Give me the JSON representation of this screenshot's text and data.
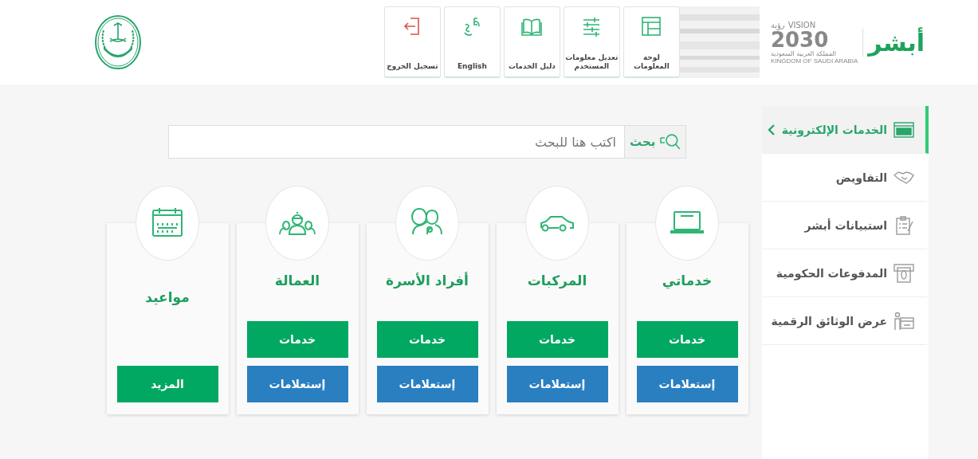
{
  "header": {
    "logo": {
      "mark": "أبشر",
      "vision": "VISION",
      "vision_ar": "رؤية",
      "year": "2030",
      "country_ar": "المملكة العربية السعودية",
      "country_en": "KINGDOM OF SAUDI ARABIA"
    },
    "nav": [
      {
        "label": "لوحة المعلومات"
      },
      {
        "label": "تعديل معلومات المستخدم"
      },
      {
        "label": "دليل الخدمات"
      },
      {
        "label": "English"
      },
      {
        "label": "تسجيل الخروج"
      }
    ]
  },
  "sidebar": {
    "items": [
      {
        "label": "الخدمات الإلكترونية",
        "selected": true
      },
      {
        "label": "التفاويض",
        "selected": false
      },
      {
        "label": "استبيانات أبشر",
        "selected": false
      },
      {
        "label": "المدفوعات الحكومية",
        "selected": false
      },
      {
        "label": "عرض الوثائق الرقمية",
        "selected": false
      }
    ]
  },
  "search": {
    "button": "بحث",
    "placeholder": "اكتب هنا للبحث"
  },
  "cards": [
    {
      "title": "خدماتي",
      "kind": "service",
      "buttons": [
        {
          "label": "خدمات",
          "kind": "services"
        },
        {
          "label": "إستعلامات",
          "kind": "inquiries"
        }
      ]
    },
    {
      "title": "المركبات",
      "kind": "service",
      "buttons": [
        {
          "label": "خدمات",
          "kind": "services"
        },
        {
          "label": "إستعلامات",
          "kind": "inquiries"
        }
      ]
    },
    {
      "title": "أفراد الأسرة",
      "kind": "service",
      "buttons": [
        {
          "label": "خدمات",
          "kind": "services"
        },
        {
          "label": "إستعلامات",
          "kind": "inquiries"
        }
      ]
    },
    {
      "title": "العمالة",
      "kind": "service",
      "buttons": [
        {
          "label": "خدمات",
          "kind": "services"
        },
        {
          "label": "إستعلامات",
          "kind": "inquiries"
        }
      ]
    },
    {
      "title": "مواعيد",
      "kind": "more",
      "buttons": [
        {
          "label": "المزيد",
          "kind": "services"
        }
      ]
    }
  ]
}
